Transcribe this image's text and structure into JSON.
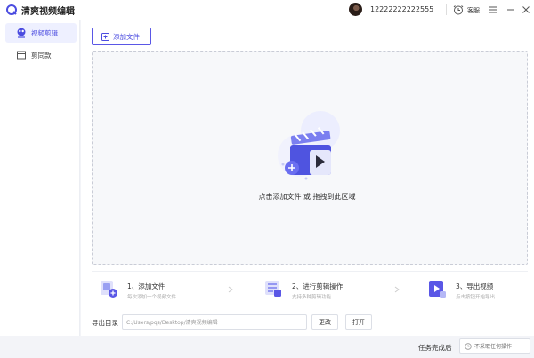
{
  "app": {
    "title": "清爽视频编辑"
  },
  "user": {
    "name": "12222222222555"
  },
  "titlebar": {
    "clock_label": "客服"
  },
  "sidebar": {
    "items": [
      {
        "label": "视频剪辑",
        "icon": "scissors-film-icon",
        "active": true
      },
      {
        "label": "剪同款",
        "icon": "template-icon",
        "active": false
      }
    ]
  },
  "toolbar": {
    "add_file_label": "添加文件"
  },
  "dropzone": {
    "hint": "点击添加文件 或 拖拽到此区域"
  },
  "steps": [
    {
      "title": "1、添加文件",
      "desc": "每次添加一个视频文件",
      "icon": "add-file-icon"
    },
    {
      "title": "2、进行剪辑操作",
      "desc": "支持多种剪辑功能",
      "icon": "edit-icon"
    },
    {
      "title": "3、导出视频",
      "desc": "点击按钮开始导出",
      "icon": "export-video-icon"
    }
  ],
  "output": {
    "label": "导出目录",
    "path": "C:/Users/pqs/Desktop/清爽视频编辑",
    "change_label": "更改",
    "open_label": "打开"
  },
  "status": {
    "done_label": "任务完成后",
    "done_option": "不采取任何操作"
  },
  "colors": {
    "accent": "#5a57e6",
    "accent_light": "#eef0ff"
  }
}
